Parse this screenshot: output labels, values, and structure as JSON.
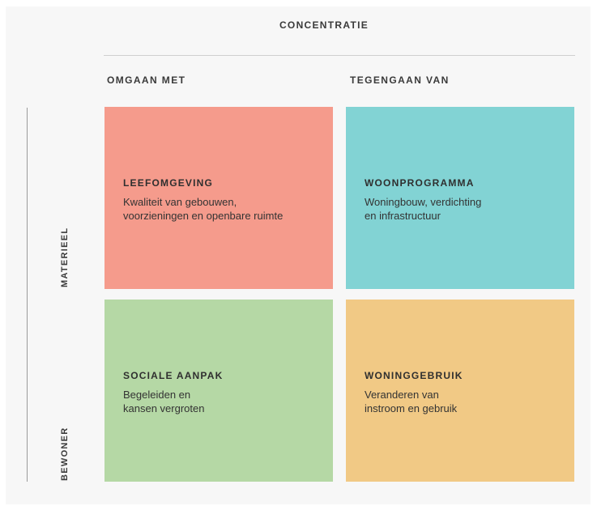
{
  "title": "CONCENTRATIE",
  "columns": [
    "OMGAAN MET",
    "TEGENGAAN VAN"
  ],
  "rows": [
    "MATERIEEL",
    "BEWONER"
  ],
  "cells": [
    {
      "title": "LEEFOMGEVING",
      "lines": [
        "Kwaliteit van gebouwen,",
        "voorzieningen en openbare ruimte"
      ],
      "color": "#f59b8c"
    },
    {
      "title": "WOONPROGRAMMA",
      "lines": [
        "Woningbouw, verdichting",
        "en infrastructuur"
      ],
      "color": "#82d3d4"
    },
    {
      "title": "SOCIALE AANPAK",
      "lines": [
        "Begeleiden en",
        "kansen vergroten"
      ],
      "color": "#b5d8a5"
    },
    {
      "title": "WONINGGEBRUIK",
      "lines": [
        "Veranderen van",
        "instroom en gebruik"
      ],
      "color": "#f1c985"
    }
  ]
}
